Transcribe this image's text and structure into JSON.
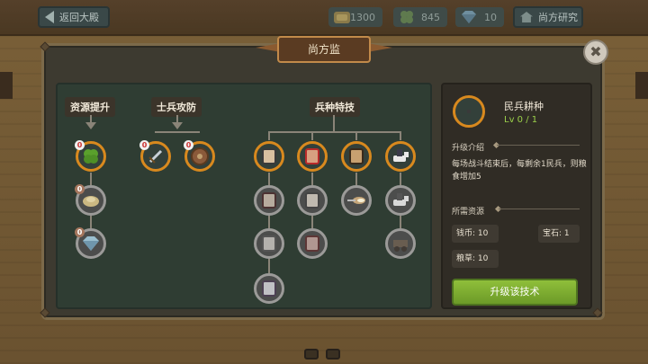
{
  "topbar": {
    "back_label": "返回大殿",
    "gold": "1300",
    "clover": "845",
    "gems": "10",
    "research_label": "尚方研究"
  },
  "panel": {
    "title": "尚方监",
    "close_label": "✖"
  },
  "tree": {
    "categories": [
      "资源提升",
      "士兵攻防",
      "兵种特技"
    ],
    "badge_value": "0"
  },
  "detail": {
    "name": "民兵耕种",
    "level": "Lv 0 / 1",
    "intro_title": "升级介绍",
    "description": "每场战斗结束后，每剩余1民兵，则粮食增加5",
    "resources_title": "所需资源",
    "costs": {
      "coins": "钱币: 10",
      "gems": "宝石: 1",
      "grain": "粮草: 10"
    },
    "upgrade_label": "升级该技术"
  },
  "colors": {
    "accent_orange": "#d8891e",
    "upgrade_green": "#7fae32",
    "level_green": "#9bd04a"
  }
}
